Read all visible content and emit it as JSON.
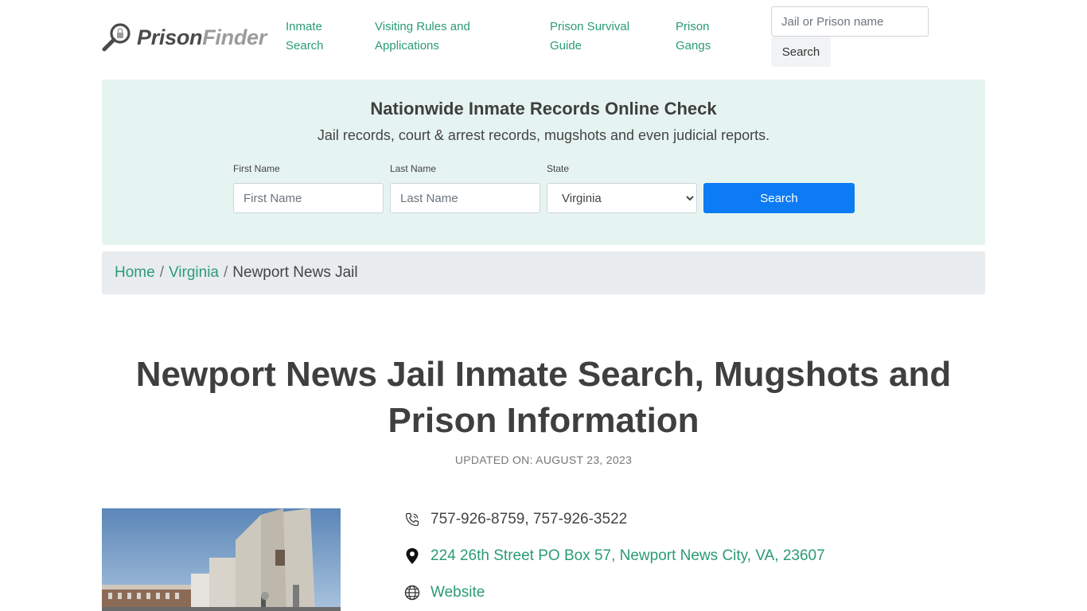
{
  "logo": {
    "part1": "Prison",
    "part2": "Finder",
    "icon": "magnifier-lock-icon"
  },
  "nav": [
    {
      "label": "Inmate Search"
    },
    {
      "label": "Visiting Rules and Applications"
    },
    {
      "label": "Prison Survival Guide"
    },
    {
      "label": "Prison Gangs"
    }
  ],
  "top_search": {
    "placeholder": "Jail or Prison name",
    "button": "Search"
  },
  "banner": {
    "title": "Nationwide Inmate Records Online Check",
    "subtitle": "Jail records, court & arrest records, mugshots and even judicial reports.",
    "first_name_label": "First Name",
    "first_name_placeholder": "First Name",
    "last_name_label": "Last Name",
    "last_name_placeholder": "Last Name",
    "state_label": "State",
    "state_value": "Virginia",
    "button": "Search"
  },
  "breadcrumb": {
    "home": "Home",
    "state": "Virginia",
    "current": "Newport News Jail",
    "separator": "/"
  },
  "page_title": "Newport News Jail Inmate Search, Mugshots and Prison Information",
  "updated": "UPDATED ON: AUGUST 23, 2023",
  "contact": {
    "phone": "757-926-8759, 757-926-3522",
    "address": "224 26th Street PO Box 57, Newport News City, VA, 23607",
    "website": "Website"
  },
  "colors": {
    "accent": "#2a9b77",
    "banner_bg": "#e6f4f1",
    "primary_button": "#0d7bf4",
    "breadcrumb_bg": "#e9ecef"
  }
}
